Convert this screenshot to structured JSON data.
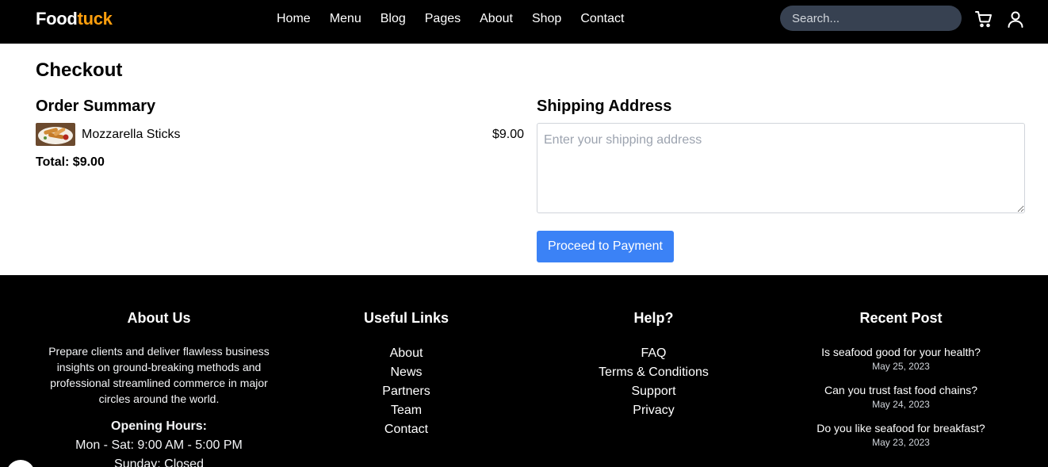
{
  "header": {
    "logo_main": "Food",
    "logo_accent": "tuck",
    "nav": [
      "Home",
      "Menu",
      "Blog",
      "Pages",
      "About",
      "Shop",
      "Contact"
    ],
    "search_placeholder": "Search...",
    "cart_icon": "cart-icon",
    "user_icon": "user-icon"
  },
  "checkout": {
    "title": "Checkout",
    "order_summary_title": "Order Summary",
    "items": [
      {
        "name": "Mozzarella Sticks",
        "price": "$9.00"
      }
    ],
    "total": "Total: $9.00",
    "shipping_title": "Shipping Address",
    "shipping_placeholder": "Enter your shipping address",
    "pay_button": "Proceed to Payment"
  },
  "footer": {
    "about": {
      "title": "About Us",
      "text": "Prepare clients and deliver flawless business insights on ground-breaking methods and professional streamlined commerce in major circles around the world.",
      "hours_title": "Opening Hours:",
      "hours_weekday": "Mon - Sat: 9:00 AM - 5:00 PM",
      "hours_sunday": "Sunday: Closed"
    },
    "useful_links": {
      "title": "Useful Links",
      "items": [
        "About",
        "News",
        "Partners",
        "Team",
        "Contact"
      ]
    },
    "help": {
      "title": "Help?",
      "items": [
        "FAQ",
        "Terms & Conditions",
        "Support",
        "Privacy"
      ]
    },
    "recent_post": {
      "title": "Recent Post",
      "posts": [
        {
          "title": "Is seafood good for your health?",
          "date": "May 25, 2023"
        },
        {
          "title": "Can you trust fast food chains?",
          "date": "May 24, 2023"
        },
        {
          "title": "Do you like seafood for breakfast?",
          "date": "May 23, 2023"
        }
      ]
    }
  },
  "colors": {
    "accent": "#ff9f0d",
    "primary_button": "#3b82f6",
    "header_bg": "#000000",
    "search_bg": "#374151"
  }
}
